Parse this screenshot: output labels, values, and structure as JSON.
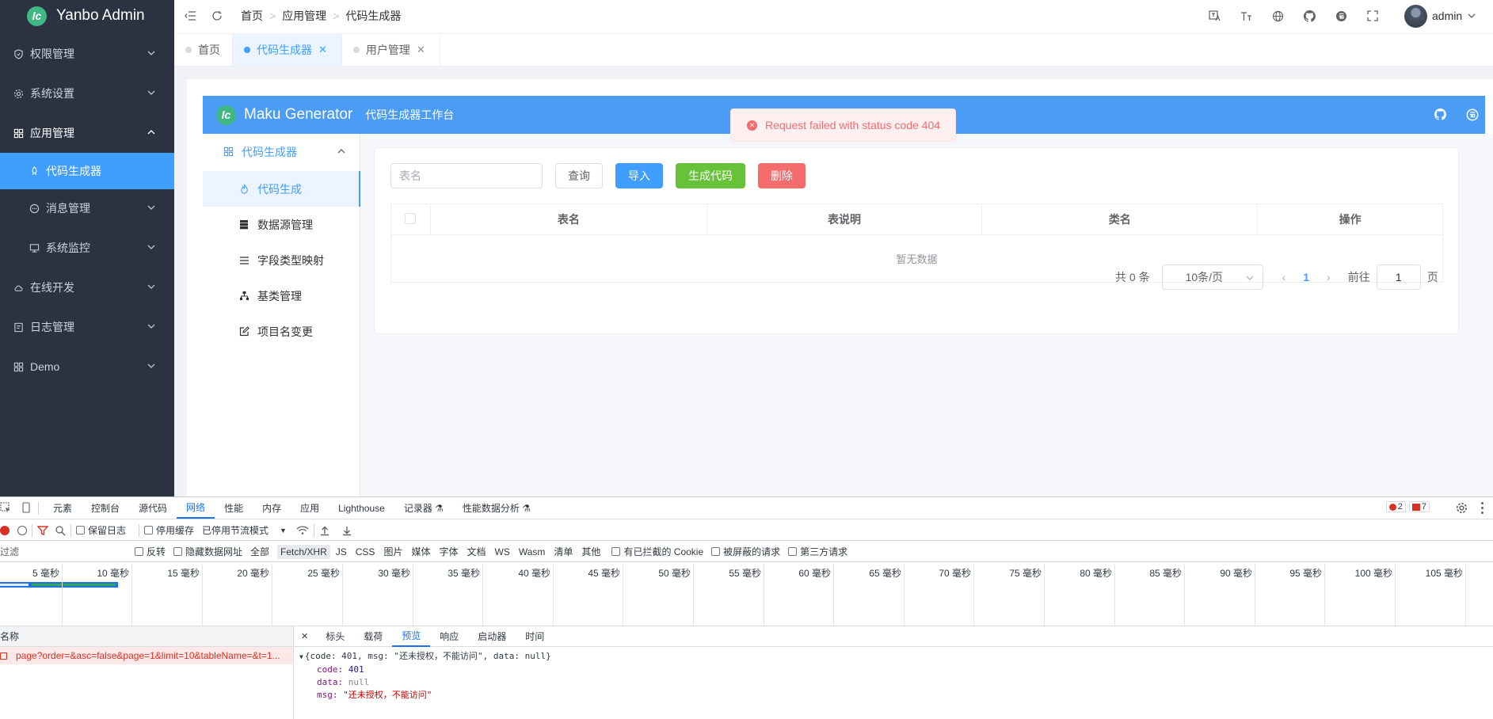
{
  "app": {
    "name": "Yanbo Admin"
  },
  "sidebar": {
    "items": [
      {
        "label": "权限管理",
        "icon": "shield-icon"
      },
      {
        "label": "系统设置",
        "icon": "gear-icon"
      },
      {
        "label": "应用管理",
        "icon": "grid-icon"
      },
      {
        "label": "代码生成器",
        "icon": "rocket-icon"
      },
      {
        "label": "消息管理",
        "icon": "chat-icon"
      },
      {
        "label": "系统监控",
        "icon": "monitor-icon"
      },
      {
        "label": "在线开发",
        "icon": "cloud-icon"
      },
      {
        "label": "日志管理",
        "icon": "log-icon"
      },
      {
        "label": "Demo",
        "icon": "grid-icon"
      }
    ]
  },
  "header": {
    "breadcrumb": [
      "首页",
      "应用管理",
      "代码生成器"
    ],
    "user": "admin"
  },
  "tabs": [
    {
      "label": "首页"
    },
    {
      "label": "代码生成器",
      "active": true
    },
    {
      "label": "用户管理"
    }
  ],
  "generator": {
    "title": "Maku Generator",
    "subtitle": "代码生成器工作台",
    "menu": [
      {
        "label": "代码生成器",
        "icon": "grid-icon"
      },
      {
        "label": "代码生成",
        "icon": "flame-icon"
      },
      {
        "label": "数据源管理",
        "icon": "database-icon"
      },
      {
        "label": "字段类型映射",
        "icon": "list-icon"
      },
      {
        "label": "基类管理",
        "icon": "org-icon"
      },
      {
        "label": "项目名变更",
        "icon": "edit-icon"
      }
    ],
    "search_placeholder": "表名",
    "buttons": {
      "query": "查询",
      "import": "导入",
      "generate": "生成代码",
      "delete": "删除"
    },
    "table": {
      "columns": [
        "表名",
        "表说明",
        "类名",
        "操作"
      ],
      "empty_text": "暂无数据"
    },
    "pagination": {
      "total": "共 0 条",
      "page_size": "10条/页",
      "current_page": "1",
      "goto_label": "前往",
      "goto_value": "1",
      "page_suffix": "页"
    }
  },
  "toast": {
    "message": "Request failed with status code 404"
  },
  "devtools": {
    "tabs": [
      "元素",
      "控制台",
      "源代码",
      "网络",
      "性能",
      "内存",
      "应用",
      "Lighthouse",
      "记录器 ⚗",
      "性能数据分析 ⚗"
    ],
    "active_tab": "网络",
    "error_count": "2",
    "warning_count": "7",
    "toolbar": {
      "preserve_log": "保留日志",
      "disable_cache": "停用缓存",
      "throttle": "已停用节流模式"
    },
    "filter": {
      "placeholder": "过滤",
      "invert": "反转",
      "hide_data_urls": "隐藏数据网址",
      "types": [
        "全部",
        "Fetch/XHR",
        "JS",
        "CSS",
        "图片",
        "媒体",
        "字体",
        "文档",
        "WS",
        "Wasm",
        "清单",
        "其他"
      ],
      "blocked_cookies": "有已拦截的 Cookie",
      "blocked_requests": "被屏蔽的请求",
      "third_party": "第三方请求"
    },
    "timeline_ticks": [
      "5 毫秒",
      "10 毫秒",
      "15 毫秒",
      "20 毫秒",
      "25 毫秒",
      "30 毫秒",
      "35 毫秒",
      "40 毫秒",
      "45 毫秒",
      "50 毫秒",
      "55 毫秒",
      "60 毫秒",
      "65 毫秒",
      "70 毫秒",
      "75 毫秒",
      "80 毫秒",
      "85 毫秒",
      "90 毫秒",
      "95 毫秒",
      "100 毫秒",
      "105 毫秒"
    ],
    "name_header": "名称",
    "request": "page?order=&asc=false&page=1&limit=10&tableName=&t=1...",
    "detail_tabs": [
      "标头",
      "载荷",
      "预览",
      "响应",
      "启动器",
      "时间"
    ],
    "active_detail_tab": "预览",
    "preview": {
      "summary": "{code: 401, msg: \"还未授权，不能访问\", data: null}",
      "code_key": "code:",
      "code_val": "401",
      "data_key": "data:",
      "data_val": "null",
      "msg_key": "msg:",
      "msg_val": "\"还未授权，不能访问\""
    }
  }
}
